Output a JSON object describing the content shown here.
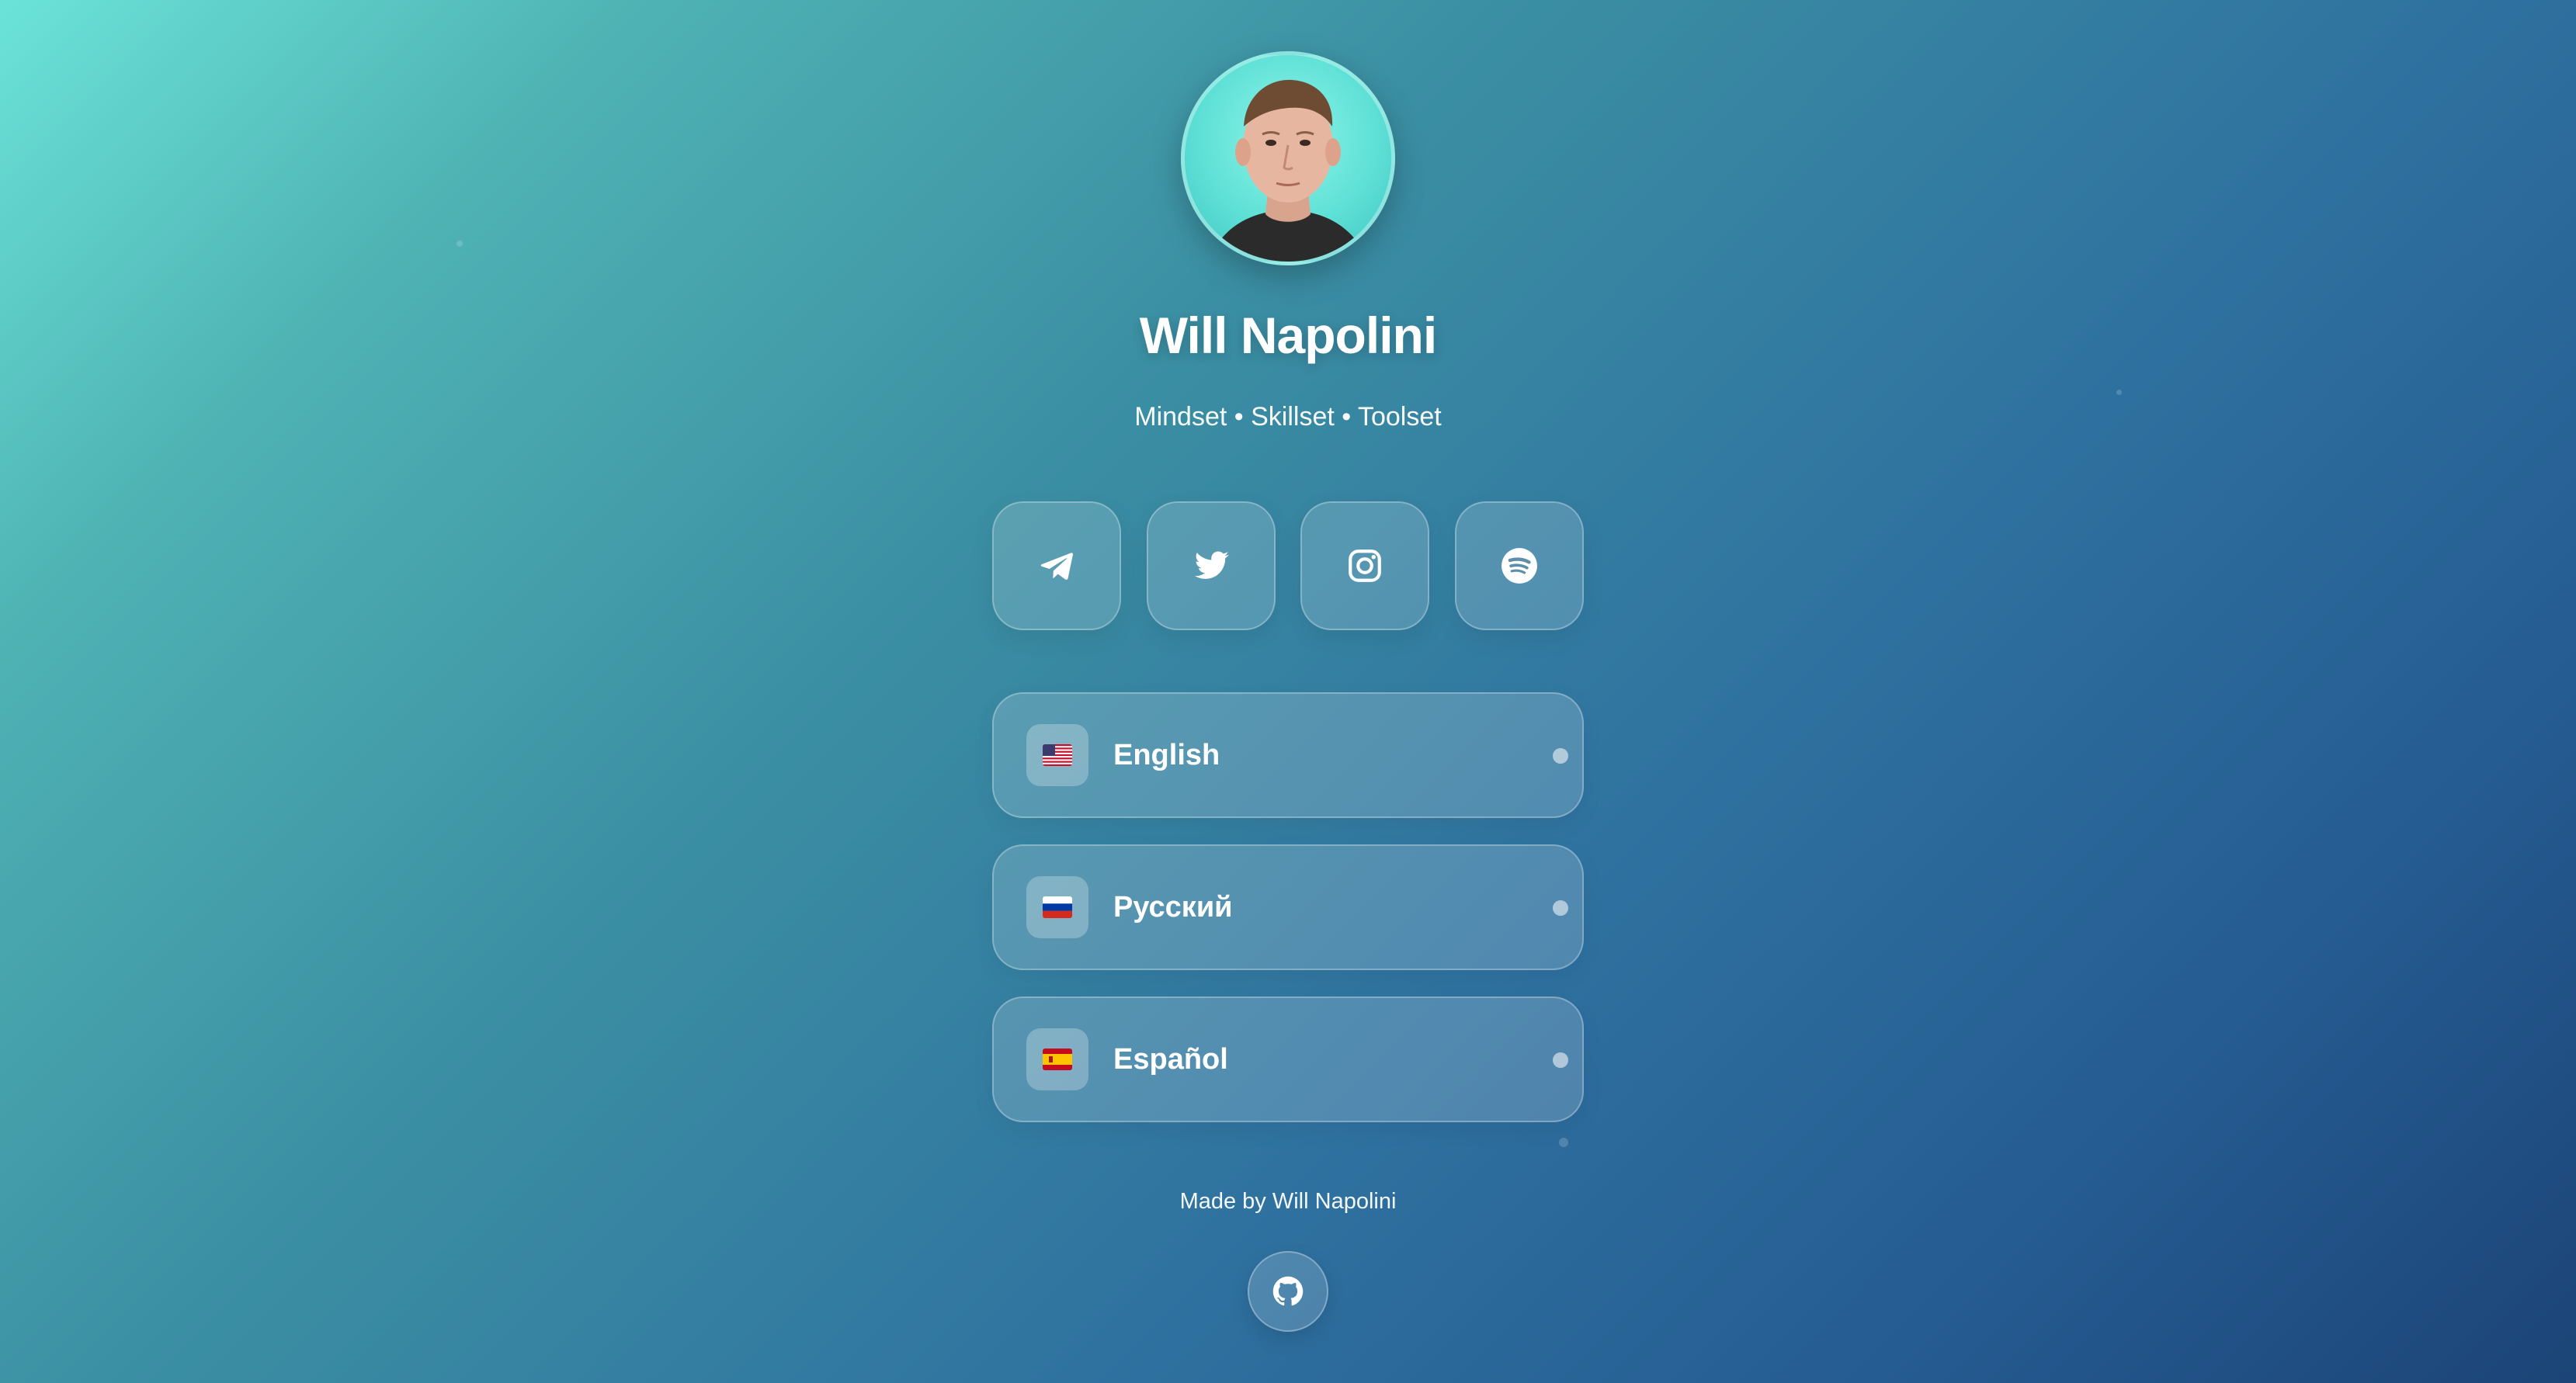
{
  "profile": {
    "name": "Will Napolini",
    "tagline": "Mindset • Skillset • Toolset",
    "avatar_alt": "avatar"
  },
  "social": [
    {
      "id": "telegram",
      "icon": "telegram-icon"
    },
    {
      "id": "twitter",
      "icon": "twitter-icon"
    },
    {
      "id": "instagram",
      "icon": "instagram-icon"
    },
    {
      "id": "spotify",
      "icon": "spotify-icon"
    }
  ],
  "languages": [
    {
      "label": "English",
      "flag": "us-flag-icon"
    },
    {
      "label": "Русский",
      "flag": "ru-flag-icon"
    },
    {
      "label": "Español",
      "flag": "es-flag-icon"
    }
  ],
  "footer": {
    "text": "Made by Will Napolini",
    "github_icon": "github-icon"
  },
  "colors": {
    "gradient_start": "#6be3d8",
    "gradient_end": "#1c4477",
    "avatar_bg": "#5ee0d6"
  }
}
